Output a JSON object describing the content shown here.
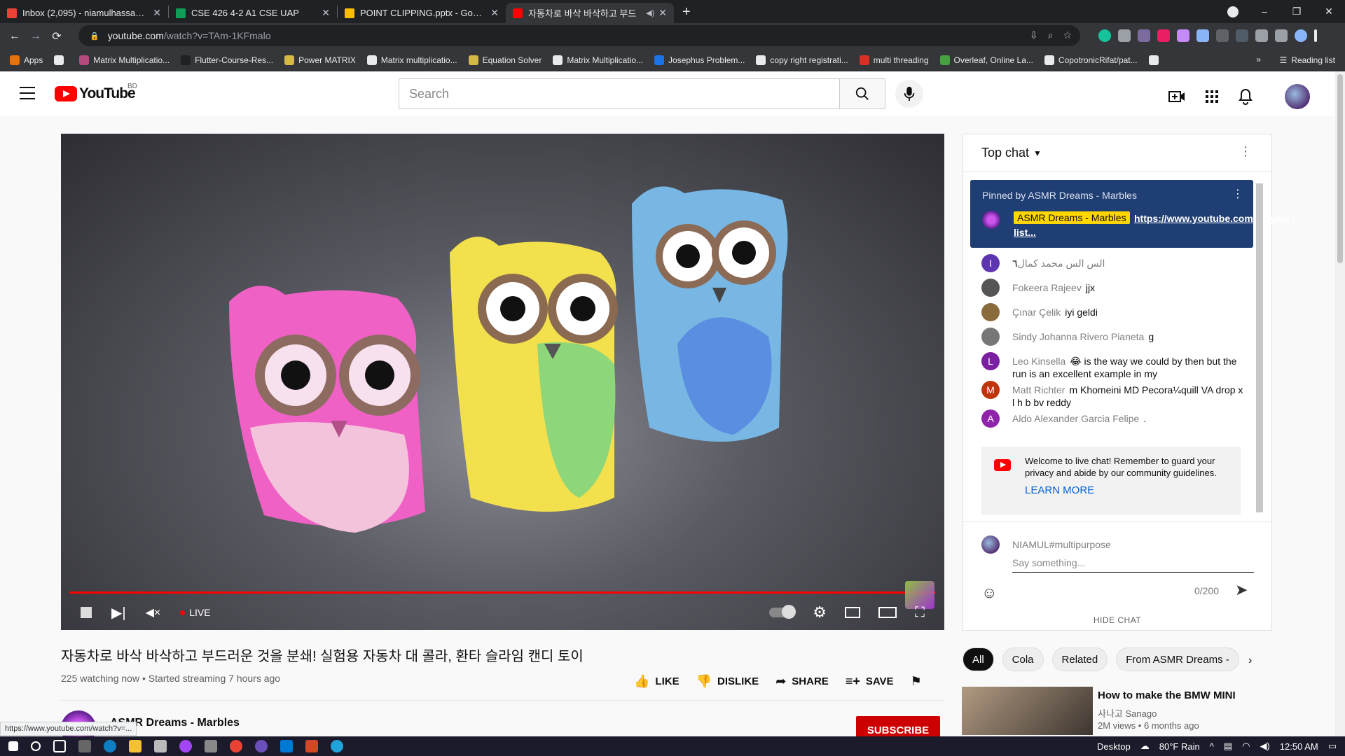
{
  "browser": {
    "tabs": [
      {
        "title": "Inbox (2,095) - niamulhassan64@",
        "fav": "#ea4335"
      },
      {
        "title": "CSE 426 4-2 A1 CSE UAP",
        "fav": "#0f9d58"
      },
      {
        "title": "POINT CLIPPING.pptx - Google D",
        "fav": "#fbbc04"
      },
      {
        "title": "자동차로 바삭 바삭하고 부드",
        "fav": "#ff0000"
      }
    ],
    "url_host": "youtube.com",
    "url_path": "/watch?v=TAm-1KFmalo",
    "bookmarks": [
      {
        "label": "Apps",
        "color": "#e8710a"
      },
      {
        "label": "",
        "color": "#e8eaed"
      },
      {
        "label": "Matrix Multiplicatio...",
        "color": "#b34b7f"
      },
      {
        "label": "Flutter-Course-Res...",
        "color": "#202124"
      },
      {
        "label": "Power MATRIX",
        "color": "#d4b84a"
      },
      {
        "label": "Matrix multiplicatio...",
        "color": "#e8eaed"
      },
      {
        "label": "Equation Solver",
        "color": "#d4b84a"
      },
      {
        "label": "Matrix Multiplicatio...",
        "color": "#e8eaed"
      },
      {
        "label": "Josephus Problem...",
        "color": "#1a73e8"
      },
      {
        "label": "copy right registrati...",
        "color": "#e8eaed"
      },
      {
        "label": "multi threading",
        "color": "#d93025"
      },
      {
        "label": "Overleaf, Online La...",
        "color": "#47a141"
      },
      {
        "label": "CopotronicRifat/pat...",
        "color": "#e8eaed"
      },
      {
        "label": "",
        "color": "#e8eaed"
      }
    ],
    "reading_list": "Reading list",
    "more_bookmarks": "»"
  },
  "youtube": {
    "country": "BD",
    "search_placeholder": "Search"
  },
  "player": {
    "live_label": "LIVE",
    "progress_fraction": 1.0
  },
  "video": {
    "title": "자동차로 바삭 바삭하고 부드러운 것을 분쇄! 실험용 자동차 대 콜라, 환타 슬라임 캔디 토이",
    "meta": "225 watching now • Started streaming 7 hours ago",
    "like": "LIKE",
    "dislike": "DISLIKE",
    "share": "SHARE",
    "save": "SAVE",
    "channel": "ASMR Dreams - Marbles",
    "subscribe": "SUBSCRIBE",
    "status_url": "https://www.youtube.com/watch?v=..."
  },
  "chat": {
    "header": "Top chat",
    "pinned_by": "Pinned by ASMR Dreams - Marbles",
    "pinned_badge": "ASMR Dreams - Marbles",
    "pinned_link": "https://www.youtube.com/playlist?list...",
    "messages": [
      {
        "initial": "I",
        "color": "#5e35b1",
        "name": "الس الس محمد كمال",
        "text": "٦"
      },
      {
        "initial": "",
        "color": "#555",
        "name": "Fokeera Rajeev",
        "text": "jjx"
      },
      {
        "initial": "",
        "color": "#8a6b3b",
        "name": "Çınar Çelik",
        "text": "iyi geldi"
      },
      {
        "initial": "",
        "color": "#777",
        "name": "Sindy Johanna Rivero Pianeta",
        "text": "g"
      },
      {
        "initial": "L",
        "color": "#7b1fa2",
        "name": "Leo Kinsella",
        "text": "😂 is the way we could by then but the run is an excellent example in my"
      },
      {
        "initial": "M",
        "color": "#bf360c",
        "name": "Matt Richter",
        "text": "m Khomeini MD Pecora¼quill VA drop x l h b bv reddy"
      },
      {
        "initial": "A",
        "color": "#8e24aa",
        "name": "Aldo Alexander Garcia Felipe",
        "text": "."
      }
    ],
    "welcome": "Welcome to live chat! Remember to guard your privacy and abide by our community guidelines.",
    "learn_more": "LEARN MORE",
    "user_name": "NIAMUL#multipurpose",
    "say_placeholder": "Say something...",
    "counter": "0/200",
    "hide_chat": "HIDE CHAT"
  },
  "chips": [
    "All",
    "Cola",
    "Related",
    "From ASMR Dreams -"
  ],
  "recommendation": {
    "title": "How to make the BMW MINI",
    "channel": "사나고 Sanago",
    "views": "2M views • 6 months ago"
  },
  "taskbar": {
    "desktop": "Desktop",
    "weather": "80°F  Rain",
    "time": "12:50 AM"
  }
}
